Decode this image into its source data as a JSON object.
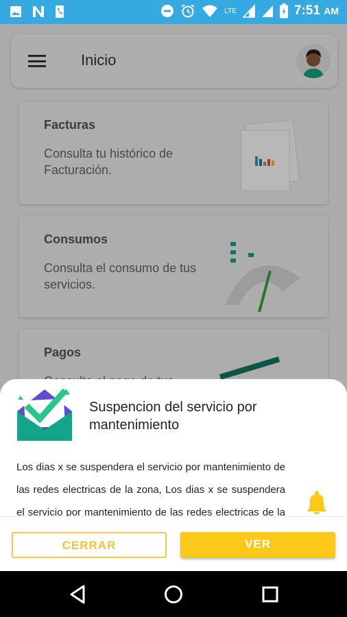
{
  "status_bar": {
    "time": "7:51",
    "ampm": "AM",
    "network": "LTE",
    "left_icons": [
      "image-icon",
      "n-app-icon",
      "phone-icon"
    ],
    "right_icons": [
      "dnd-icon",
      "alarm-icon",
      "wifi-icon",
      "signal-icon",
      "battery-icon"
    ]
  },
  "app_bar": {
    "title": "Inicio",
    "menu_icon": "hamburger-icon",
    "avatar_icon": "user-avatar-icon"
  },
  "cards": [
    {
      "title": "Facturas",
      "description": "Consulta tu histórico de Facturación.",
      "icon": "invoice-chart-illustration"
    },
    {
      "title": "Consumos",
      "description": "Consulta el consumo de tus servicios.",
      "icon": "gauge-illustration"
    },
    {
      "title": "Pagos",
      "description": "Consulta el pago de tus",
      "icon": "payment-illustration"
    }
  ],
  "notification": {
    "title": "Suspencion del servicio por mantenimiento",
    "body": "Los dias x se suspendera el servicio por mantenimiento de las redes electricas de la zona, Los dias x se suspendera el servicio por mantenimiento de las redes electricas de la zona.",
    "icon": "envelope-check-icon",
    "bell_icon": "bell-icon",
    "close_label": "CERRAR",
    "view_label": "VER",
    "colors": {
      "accent": "#fcc81a",
      "envelope_green": "#13a58a",
      "envelope_purple": "#5b4fc9"
    }
  },
  "nav_bar": {
    "back_icon": "back-triangle-icon",
    "home_icon": "home-circle-icon",
    "recents_icon": "recents-square-icon"
  }
}
